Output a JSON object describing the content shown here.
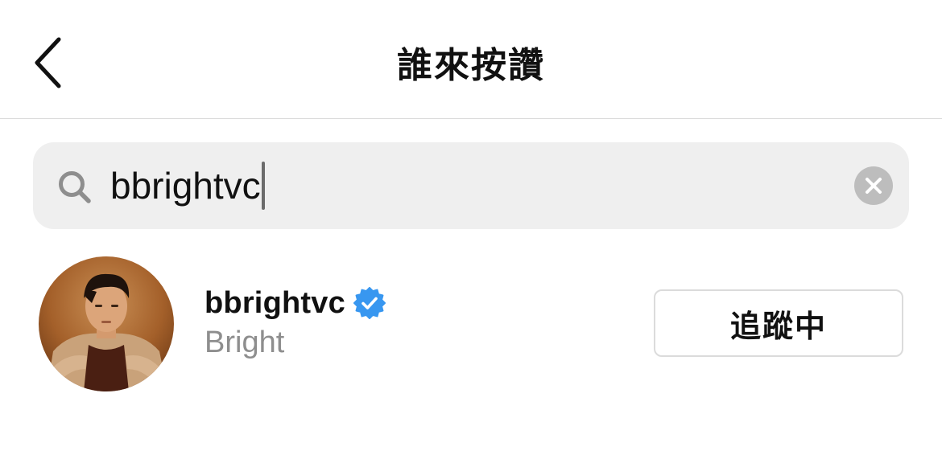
{
  "header": {
    "title": "誰來按讚",
    "back_icon": "chevron-left-icon"
  },
  "search": {
    "value": "bbrightvc",
    "search_icon": "search-icon",
    "clear_icon": "clear-circle-icon"
  },
  "results": [
    {
      "username": "bbrightvc",
      "verified": true,
      "full_name": "Bright",
      "follow_label": "追蹤中"
    }
  ],
  "colors": {
    "verified_blue": "#3897f0",
    "secondary_text": "#8e8e8e",
    "search_bg": "#efefef",
    "divider": "#dbdbdb"
  }
}
